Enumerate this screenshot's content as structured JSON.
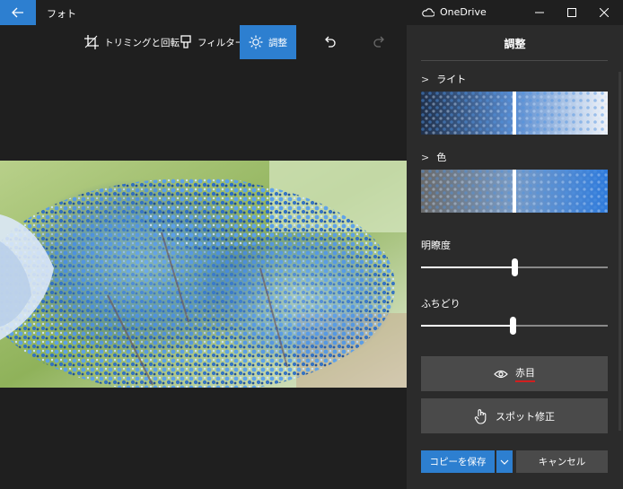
{
  "window": {
    "app_title": "フォト",
    "cloud_label": "OneDrive"
  },
  "toolbar": {
    "crop_label": "トリミングと回転",
    "filter_label": "フィルター",
    "adjust_label": "調整"
  },
  "panel": {
    "title": "調整",
    "light_label": "ライト",
    "color_label": "色",
    "light_level": 0.5,
    "color_level": 0.5,
    "clarity_label": "明瞭度",
    "clarity_value": 0.5,
    "vignette_label": "ふちどり",
    "vignette_value": 0.49,
    "redeye_label": "赤目",
    "spotfix_label": "スポット修正",
    "save_copy_label": "コピーを保存",
    "cancel_label": "キャンセル"
  },
  "icons": {
    "back": "back-arrow-icon",
    "cloud": "onedrive-icon",
    "crop": "crop-rotate-icon",
    "filter": "filter-icon",
    "adjust": "brightness-icon",
    "undo": "undo-icon",
    "redo": "redo-icon",
    "eye": "eye-icon",
    "touch": "touch-hand-icon"
  },
  "colors": {
    "accent": "#2d7fd0",
    "background": "#1f1f1f",
    "panel": "#2b2b2b",
    "button": "#4a4a4a",
    "redeye_underline": "#d11f1f"
  }
}
